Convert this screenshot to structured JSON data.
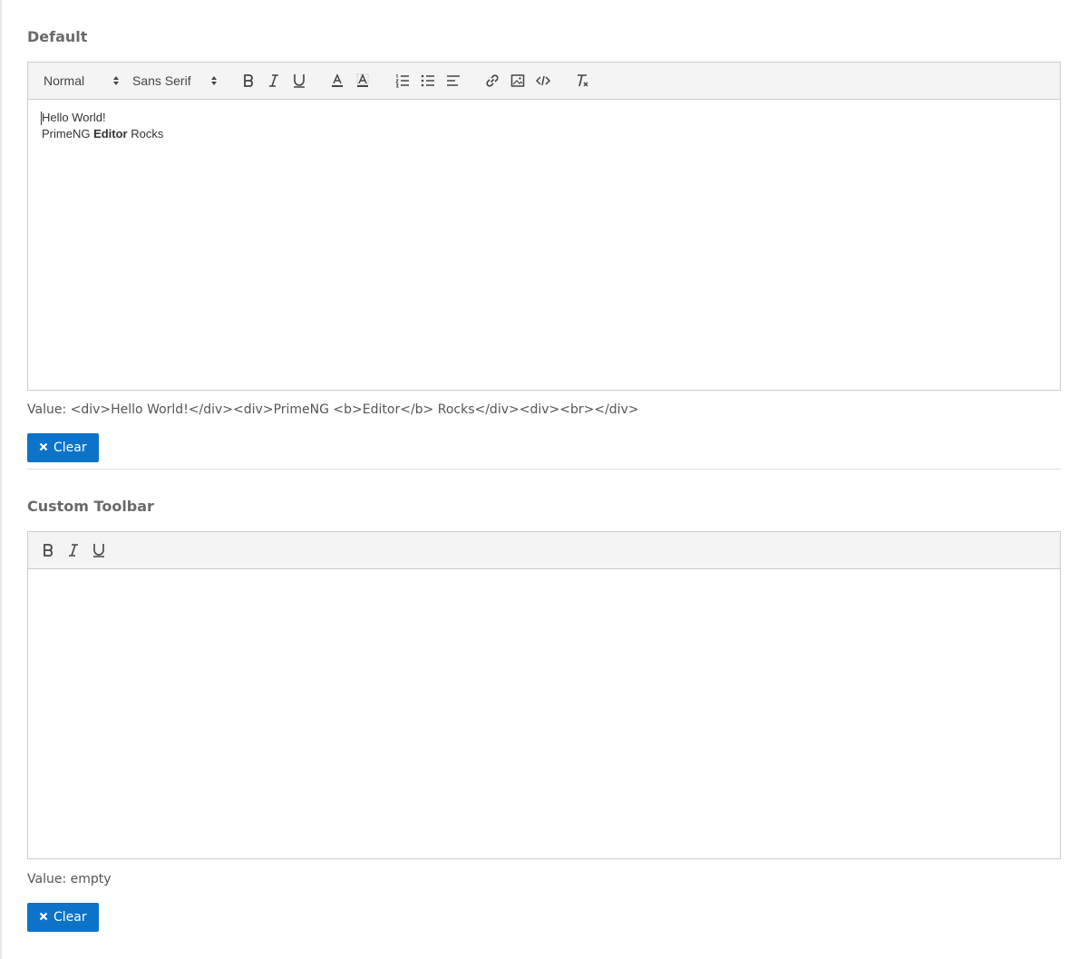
{
  "default_section": {
    "title": "Default",
    "toolbar": {
      "header_select": "Normal",
      "font_select": "Sans Serif",
      "buttons": [
        "bold-icon",
        "italic-icon",
        "underline-icon",
        "text-color-icon",
        "background-color-icon",
        "ordered-list-icon",
        "bullet-list-icon",
        "align-icon",
        "link-icon",
        "image-icon",
        "code-block-icon",
        "clear-format-icon"
      ]
    },
    "content": {
      "line1": "Hello World!",
      "line2_prefix": "PrimeNG ",
      "line2_bold": "Editor",
      "line2_suffix": " Rocks"
    },
    "value_text": "Value: <div>Hello World!</div><div>PrimeNG <b>Editor</b> Rocks</div><div><br></div>",
    "clear_label": "Clear"
  },
  "custom_section": {
    "title": "Custom Toolbar",
    "toolbar": {
      "buttons": [
        "bold-icon",
        "italic-icon",
        "underline-icon"
      ]
    },
    "value_text": "Value: empty",
    "clear_label": "Clear"
  },
  "colors": {
    "accent": "#0c73c9",
    "toolbar_bg": "#f4f4f4",
    "border": "#cccccc"
  }
}
